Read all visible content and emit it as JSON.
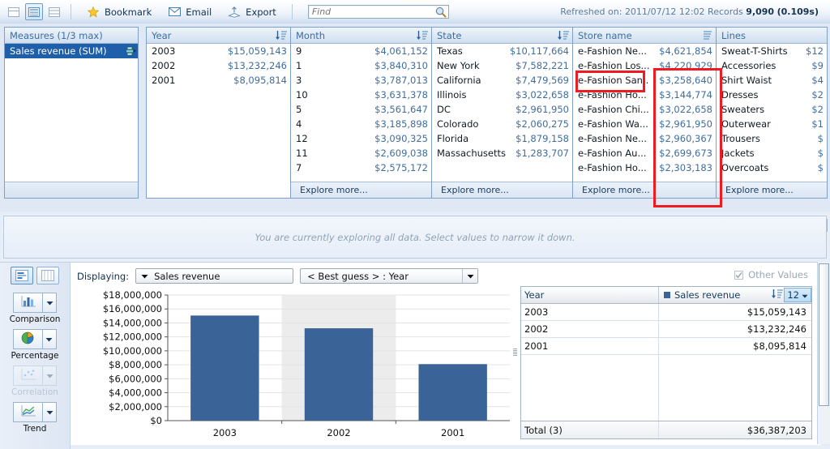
{
  "toolbar": {
    "views": [
      {
        "name": "view-single",
        "selected": false
      },
      {
        "name": "view-split-horizontal",
        "selected": true
      },
      {
        "name": "view-compact",
        "selected": false
      }
    ],
    "bookmark_label": "Bookmark",
    "email_label": "Email",
    "export_label": "Export",
    "find_placeholder": "Find",
    "find_value": "",
    "refreshed_prefix": "Refreshed on:",
    "refreshed_datetime": "2011/07/12 12:02",
    "records_label": "Records",
    "records_count": "9,090",
    "query_time": "(0.109s)"
  },
  "measures": {
    "header": "Measures (1/3 max)",
    "items": [
      {
        "label": "Sales revenue (SUM)",
        "selected": true
      }
    ]
  },
  "facets": [
    {
      "id": "facet-year",
      "header": "Year",
      "explore_more": "",
      "rows": [
        {
          "label": "2003",
          "value": "$15,059,143"
        },
        {
          "label": "2002",
          "value": "$13,232,246"
        },
        {
          "label": "2001",
          "value": "$8,095,814"
        }
      ]
    },
    {
      "id": "facet-month",
      "header": "Month",
      "explore_more": "Explore more...",
      "rows": [
        {
          "label": "9",
          "value": "$4,061,152"
        },
        {
          "label": "1",
          "value": "$3,840,310"
        },
        {
          "label": "3",
          "value": "$3,787,013"
        },
        {
          "label": "10",
          "value": "$3,631,378"
        },
        {
          "label": "5",
          "value": "$3,561,647"
        },
        {
          "label": "4",
          "value": "$3,185,898"
        },
        {
          "label": "12",
          "value": "$3,090,325"
        },
        {
          "label": "11",
          "value": "$2,609,038"
        },
        {
          "label": "7",
          "value": "$2,575,172"
        }
      ]
    },
    {
      "id": "facet-state",
      "header": "State",
      "explore_more": "Explore more...",
      "rows": [
        {
          "label": "Texas",
          "value": "$10,117,664"
        },
        {
          "label": "New York",
          "value": "$7,582,221"
        },
        {
          "label": "California",
          "value": "$7,479,569"
        },
        {
          "label": "Illinois",
          "value": "$3,022,658"
        },
        {
          "label": "DC",
          "value": "$2,961,950"
        },
        {
          "label": "Colorado",
          "value": "$2,060,275"
        },
        {
          "label": "Florida",
          "value": "$1,879,158"
        },
        {
          "label": "Massachusetts",
          "value": "$1,283,707"
        }
      ]
    },
    {
      "id": "facet-store",
      "header": "Store name",
      "explore_more": "Explore more...",
      "rows": [
        {
          "label": "e-Fashion Ne...",
          "value": "$4,621,854"
        },
        {
          "label": "e-Fashion Los...",
          "value": "$4,220,929"
        },
        {
          "label": "e-Fashion San..",
          "value": "$3,258,640"
        },
        {
          "label": "e-Fashion Ho...",
          "value": "$3,144,774"
        },
        {
          "label": "e-Fashion Chi...",
          "value": "$3,022,658"
        },
        {
          "label": "e-Fashion Wa...",
          "value": "$2,961,950"
        },
        {
          "label": "e-Fashion Ne...",
          "value": "$2,960,367"
        },
        {
          "label": "e-Fashion Au...",
          "value": "$2,699,673"
        },
        {
          "label": "e-Fashion Ho...",
          "value": "$2,303,183"
        }
      ]
    },
    {
      "id": "facet-lines",
      "header": "Lines",
      "explore_more": "Explore more...",
      "rows": [
        {
          "label": "Sweat-T-Shirts",
          "value": "$12"
        },
        {
          "label": "Accessories",
          "value": "$9"
        },
        {
          "label": "Shirt Waist",
          "value": "$4"
        },
        {
          "label": "Dresses",
          "value": "$2"
        },
        {
          "label": "Sweaters",
          "value": "$2"
        },
        {
          "label": "Outerwear",
          "value": "$1"
        },
        {
          "label": "Trousers",
          "value": "$"
        },
        {
          "label": "Jackets",
          "value": "$"
        },
        {
          "label": "Overcoats",
          "value": "$"
        }
      ]
    }
  ],
  "filter_strip": {
    "message": "You are currently exploring all data. Select values to narrow it down."
  },
  "rail": {
    "layout_buttons": [
      {
        "name": "chart-view-button",
        "selected": true
      },
      {
        "name": "table-view-button",
        "selected": false
      }
    ],
    "groups": [
      {
        "name": "comparison",
        "label": "Comparison",
        "enabled": true
      },
      {
        "name": "percentage",
        "label": "Percentage",
        "enabled": true
      },
      {
        "name": "correlation",
        "label": "Correlation",
        "enabled": false
      },
      {
        "name": "trend",
        "label": "Trend",
        "enabled": true
      }
    ]
  },
  "display_bar": {
    "label": "Displaying:",
    "measure_value": "Sales revenue",
    "dimension_value": "< Best guess > : Year",
    "other_values_label": "Other Values",
    "other_values_checked": true,
    "other_values_enabled": false
  },
  "data_table": {
    "col_year": "Year",
    "col_measure": "Sales revenue",
    "count_value": "12",
    "rows": [
      {
        "year": "2003",
        "value": "$15,059,143"
      },
      {
        "year": "2002",
        "value": "$13,232,246"
      },
      {
        "year": "2001",
        "value": "$8,095,814"
      }
    ],
    "total_label": "Total (3)",
    "total_value": "$36,387,203"
  },
  "colors": {
    "bar": "#3a6498",
    "accent": "#1f5fa9",
    "header_text": "#3f6d9e",
    "highlight_box": "#ee1c22"
  },
  "chart_data": {
    "type": "bar",
    "title": "",
    "xlabel": "",
    "ylabel": "",
    "categories": [
      "2003",
      "2002",
      "2001"
    ],
    "values": [
      15059143,
      13232246,
      8095814
    ],
    "ylim": [
      0,
      18000000
    ],
    "ytick_labels": [
      "$0",
      "$2,000,000",
      "$4,000,000",
      "$6,000,000",
      "$8,000,000",
      "$10,000,000",
      "$12,000,000",
      "$14,000,000",
      "$16,000,000",
      "$18,000,000"
    ],
    "ytick_values": [
      0,
      2000000,
      4000000,
      6000000,
      8000000,
      10000000,
      12000000,
      14000000,
      16000000,
      18000000
    ],
    "series": [
      {
        "name": "Sales revenue",
        "values": [
          15059143,
          13232246,
          8095814
        ]
      }
    ],
    "grid": true,
    "legend": "none",
    "bar_color": "#3a6498",
    "highlight_band_index": 1
  }
}
